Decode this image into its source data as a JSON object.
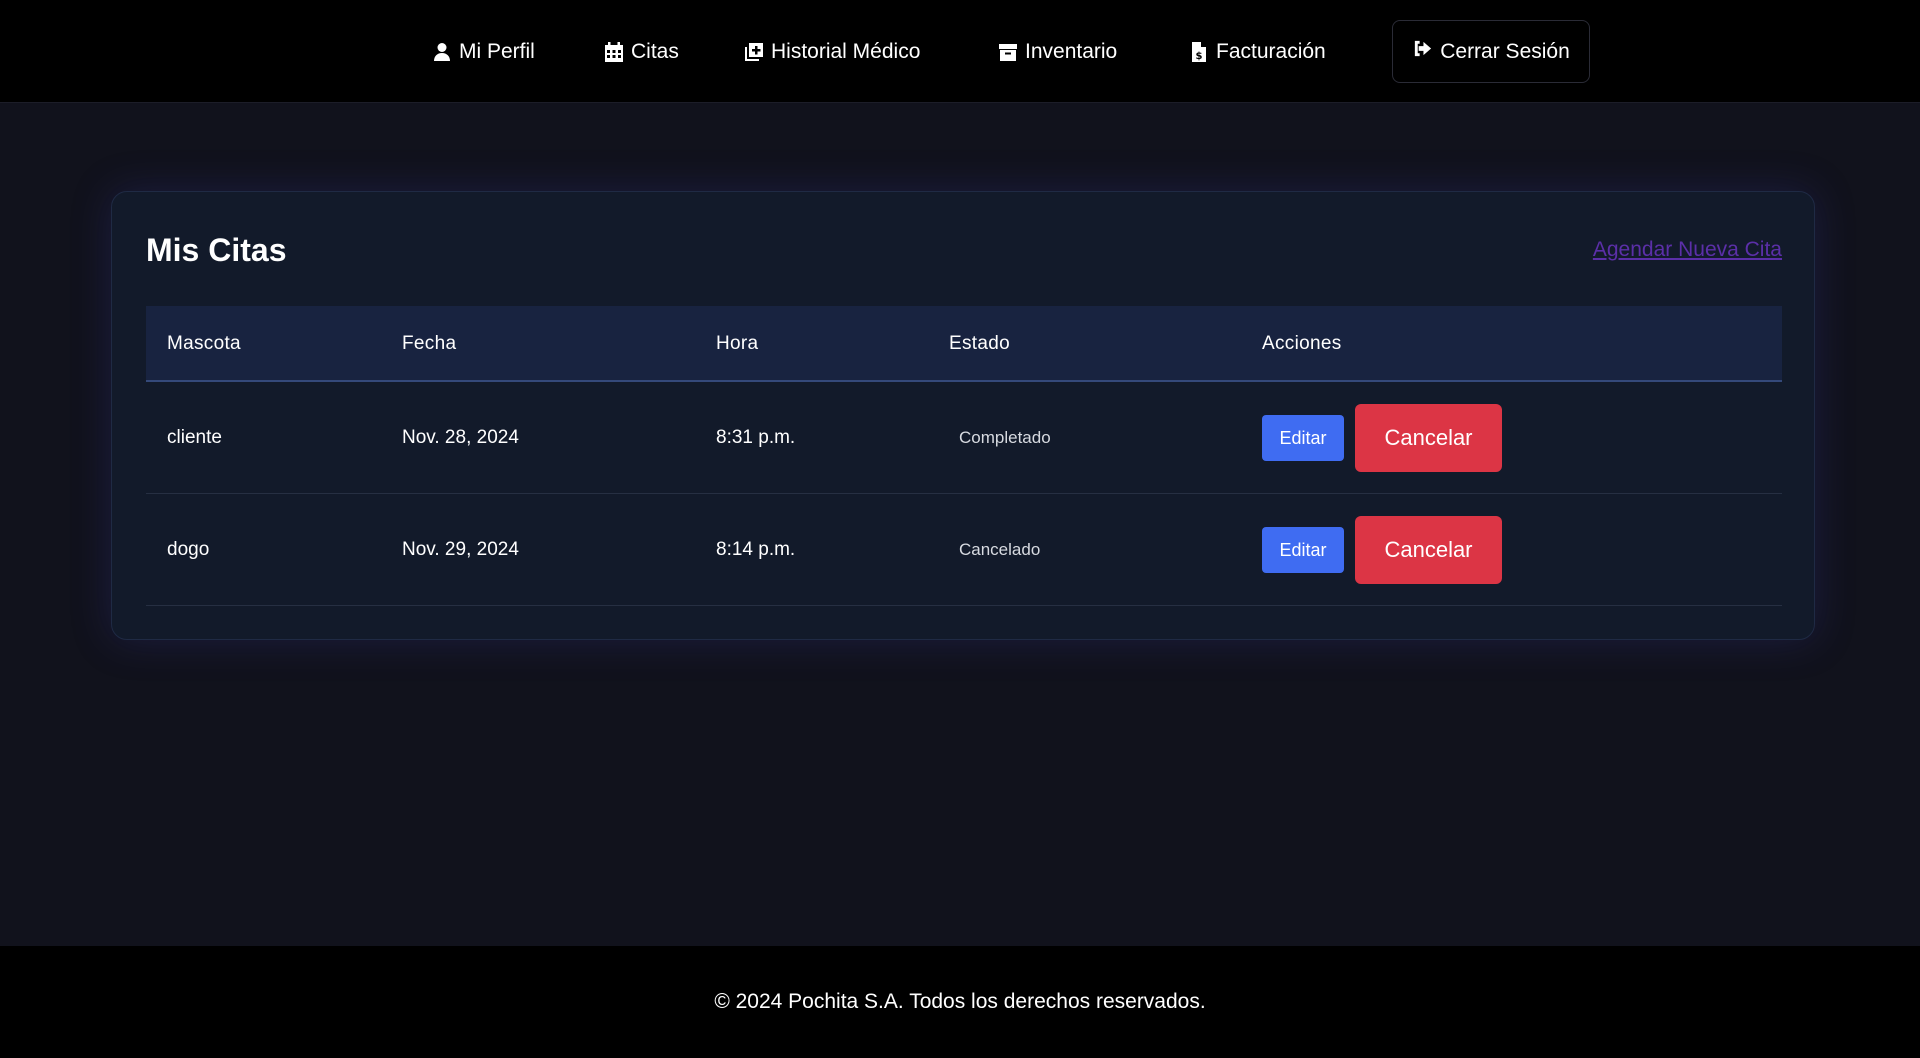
{
  "nav": {
    "items": [
      {
        "label": "Mi Perfil",
        "icon": "user-icon"
      },
      {
        "label": "Citas",
        "icon": "calendar-icon"
      },
      {
        "label": "Historial Médico",
        "icon": "medical-plus-icon"
      },
      {
        "label": "Inventario",
        "icon": "box-icon"
      },
      {
        "label": "Facturación",
        "icon": "invoice-dollar-icon"
      }
    ],
    "logout": {
      "label": "Cerrar Sesión",
      "icon": "sign-out-icon"
    }
  },
  "card": {
    "title": "Mis Citas",
    "new_link": "Agendar Nueva Cita"
  },
  "table": {
    "headers": [
      "Mascota",
      "Fecha",
      "Hora",
      "Estado",
      "Acciones"
    ],
    "rows": [
      {
        "mascota": "cliente",
        "fecha": "Nov. 28, 2024",
        "hora": "8:31 p.m.",
        "estado": "Completado",
        "edit": "Editar",
        "cancel": "Cancelar"
      },
      {
        "mascota": "dogo",
        "fecha": "Nov. 29, 2024",
        "hora": "8:14 p.m.",
        "estado": "Cancelado",
        "edit": "Editar",
        "cancel": "Cancelar"
      }
    ]
  },
  "footer": {
    "text": "© 2024 Pochita S.A. Todos los derechos reservados."
  },
  "colors": {
    "background": "#11121c",
    "navbar": "#000000",
    "card": "#121a2a",
    "table_header": "#182340",
    "link": "#5b2fa8",
    "edit_button": "#3f6cf2",
    "cancel_button": "#dc3545"
  }
}
